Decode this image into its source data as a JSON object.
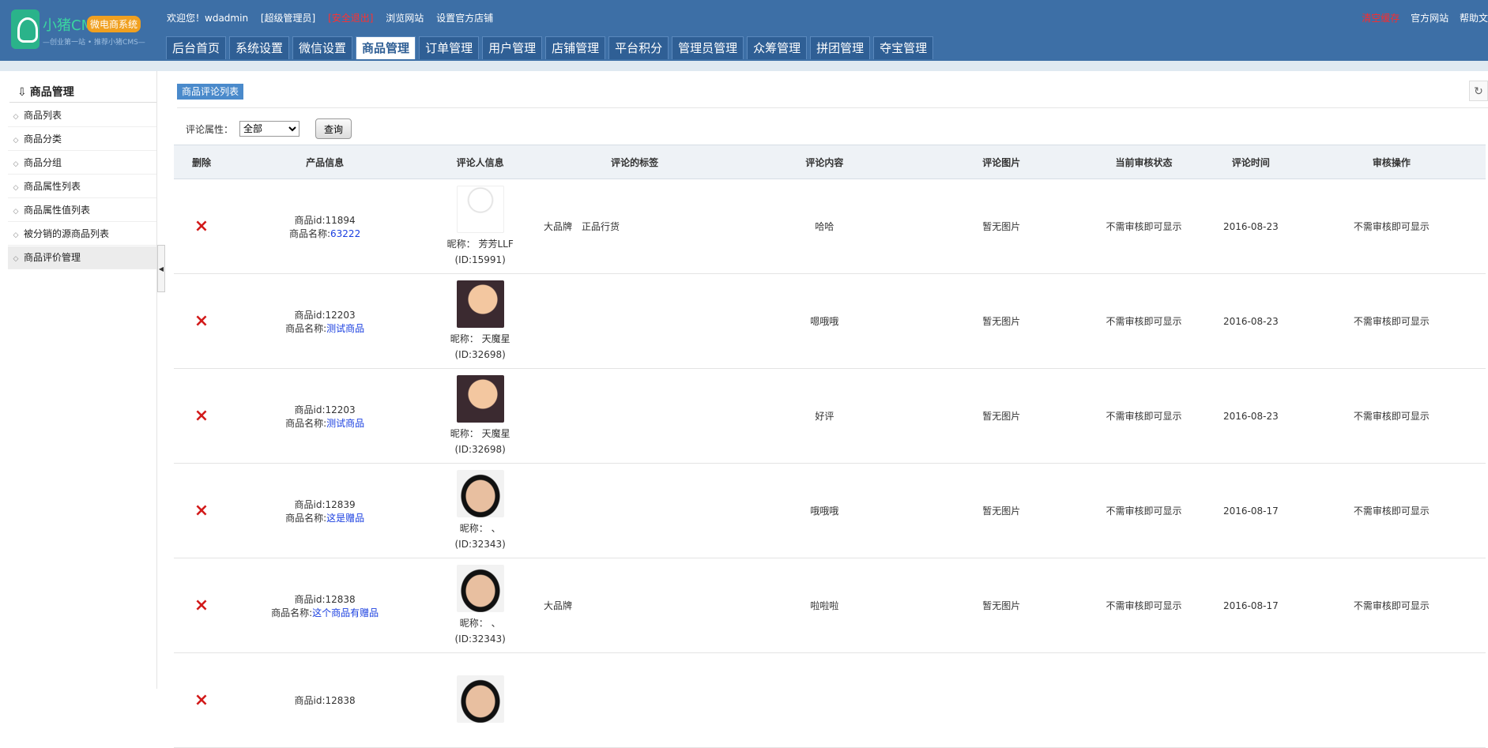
{
  "header": {
    "logo": {
      "name": "小猪CMS",
      "badge": "微电商系统",
      "slogan": "—创业第一站 • 推荐小猪CMS—"
    },
    "links": [
      "欢迎您！",
      "wdadmin",
      "[超级管理员]",
      "[安全退出]",
      "浏览网站",
      "设置官方店铺"
    ],
    "right_links": [
      "清空缓存",
      "官方网站",
      "帮助文"
    ],
    "tabs": [
      "后台首页",
      "系统设置",
      "微信设置",
      "商品管理",
      "订单管理",
      "用户管理",
      "店铺管理",
      "平台积分",
      "管理员管理",
      "众筹管理",
      "拼团管理",
      "夺宝管理"
    ],
    "active_tab": "商品管理"
  },
  "sidebar": {
    "title": "商品管理",
    "items": [
      "商品列表",
      "商品分类",
      "商品分组",
      "商品属性列表",
      "商品属性值列表",
      "被分销的源商品列表",
      "商品评价管理"
    ],
    "active_item": "商品评价管理"
  },
  "main": {
    "breadcrumb": "商品评论列表",
    "filter": {
      "label": "评论属性：",
      "selected": "全部",
      "query_button": "查询"
    },
    "columns": [
      "删除",
      "产品信息",
      "评论人信息",
      "评论的标签",
      "评论内容",
      "评论图片",
      "当前审核状态",
      "评论时间",
      "审核操作"
    ],
    "rows": [
      {
        "pid_label": "商品id:",
        "pid": "11894",
        "pname_label": "商品名称:",
        "pname": "63222",
        "nick_label": "昵称：",
        "nick": "芳芳LLF",
        "uid": "(ID:15991)",
        "avatar": "cartoon",
        "tags": "大品牌　正品行货",
        "content": "哈哈",
        "image": "暂无图片",
        "status": "不需审核即可显示",
        "time": "2016-08-23",
        "action": "不需审核即可显示"
      },
      {
        "pid_label": "商品id:",
        "pid": "12203",
        "pname_label": "商品名称:",
        "pname": "测试商品",
        "nick_label": "昵称：",
        "nick": "天魔星",
        "uid": "(ID:32698)",
        "avatar": "baby",
        "tags": "",
        "content": "嗯哦哦",
        "image": "暂无图片",
        "status": "不需审核即可显示",
        "time": "2016-08-23",
        "action": "不需审核即可显示"
      },
      {
        "pid_label": "商品id:",
        "pid": "12203",
        "pname_label": "商品名称:",
        "pname": "测试商品",
        "nick_label": "昵称：",
        "nick": "天魔星",
        "uid": "(ID:32698)",
        "avatar": "baby",
        "tags": "",
        "content": "好评",
        "image": "暂无图片",
        "status": "不需审核即可显示",
        "time": "2016-08-23",
        "action": "不需审核即可显示"
      },
      {
        "pid_label": "商品id:",
        "pid": "12839",
        "pname_label": "商品名称:",
        "pname": "这是赠品",
        "nick_label": "昵称：",
        "nick": "、",
        "uid": "(ID:32343)",
        "avatar": "man",
        "tags": "",
        "content": "哦哦哦",
        "image": "暂无图片",
        "status": "不需审核即可显示",
        "time": "2016-08-17",
        "action": "不需审核即可显示"
      },
      {
        "pid_label": "商品id:",
        "pid": "12838",
        "pname_label": "商品名称:",
        "pname": "这个商品有赠品",
        "nick_label": "昵称：",
        "nick": "、",
        "uid": "(ID:32343)",
        "avatar": "man",
        "tags": "大品牌",
        "content": "啦啦啦",
        "image": "暂无图片",
        "status": "不需审核即可显示",
        "time": "2016-08-17",
        "action": "不需审核即可显示"
      },
      {
        "pid_label": "商品id:",
        "pid": "12838",
        "pname_label": "",
        "pname": "",
        "nick_label": "",
        "nick": "",
        "uid": "",
        "avatar": "man",
        "tags": "",
        "content": "",
        "image": "",
        "status": "",
        "time": "",
        "action": ""
      }
    ]
  },
  "icons": {
    "delete": "×",
    "refresh": "↻",
    "collapse": "◀",
    "bullet": "◇",
    "nav_icon": "⇩"
  }
}
